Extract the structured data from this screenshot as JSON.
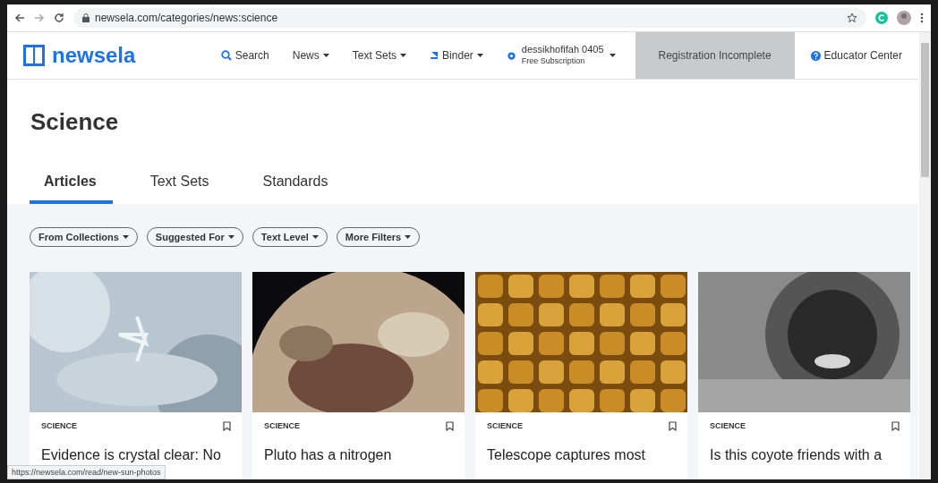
{
  "browser": {
    "url": "newsela.com/categories/news:science"
  },
  "nav": {
    "logo": "newsela",
    "search": "Search",
    "menus": [
      {
        "label": "News"
      },
      {
        "label": "Text Sets"
      },
      {
        "label": "Binder"
      }
    ],
    "user": {
      "name": "dessikhofifah 0405",
      "plan": "Free Subscription"
    },
    "registration": "Registration Incomplete",
    "educator": "Educator Center"
  },
  "page": {
    "title": "Science"
  },
  "tabs": [
    {
      "label": "Articles",
      "selected": true
    },
    {
      "label": "Text Sets",
      "selected": false
    },
    {
      "label": "Standards",
      "selected": false
    }
  ],
  "filters": [
    {
      "label": "From Collections"
    },
    {
      "label": "Suggested For"
    },
    {
      "label": "Text Level"
    },
    {
      "label": "More Filters"
    }
  ],
  "cards": [
    {
      "category": "SCIENCE",
      "title": "Evidence is crystal clear: No"
    },
    {
      "category": "SCIENCE",
      "title": "Pluto has a nitrogen"
    },
    {
      "category": "SCIENCE",
      "title": "Telescope captures most"
    },
    {
      "category": "SCIENCE",
      "title": "Is this coyote friends with a"
    }
  ],
  "status_bar": {
    "link": "https://newsela.com/read/new-sun-photos"
  }
}
